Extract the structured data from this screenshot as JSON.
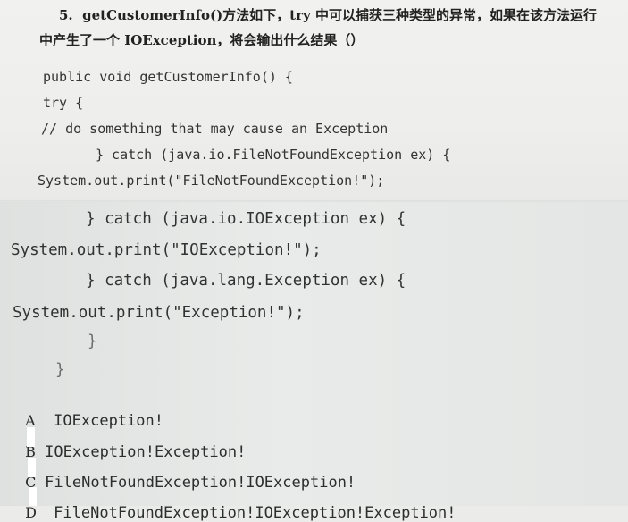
{
  "question": {
    "line1": "5.  getCustomerInfo()方法如下，try 中可以捕获三种类型的异常，如果在该方法运行",
    "line2": "中产生了一个 IOException，将会输出什么结果（）"
  },
  "code": {
    "l1": "public void getCustomerInfo() {",
    "l2": "try {",
    "l3": "// do something that may cause an Exception",
    "l4": "} catch (java.io.FileNotFoundException ex) {",
    "l5": "System.out.print(\"FileNotFoundException!\");",
    "l6": "} catch (java.io.IOException ex) {",
    "l7": "System.out.print(\"IOException!\");",
    "l8": "} catch (java.lang.Exception ex) {",
    "l9": "System.out.print(\"Exception!\");",
    "l10": "}",
    "l11": "}"
  },
  "options": [
    {
      "letter": "A",
      "text": "IOException!"
    },
    {
      "letter": "B",
      "text": "IOException!Exception!"
    },
    {
      "letter": "C",
      "text": "FileNotFoundException!IOException!"
    },
    {
      "letter": "D",
      "text": "FileNotFoundException!IOException!Exception!"
    }
  ]
}
